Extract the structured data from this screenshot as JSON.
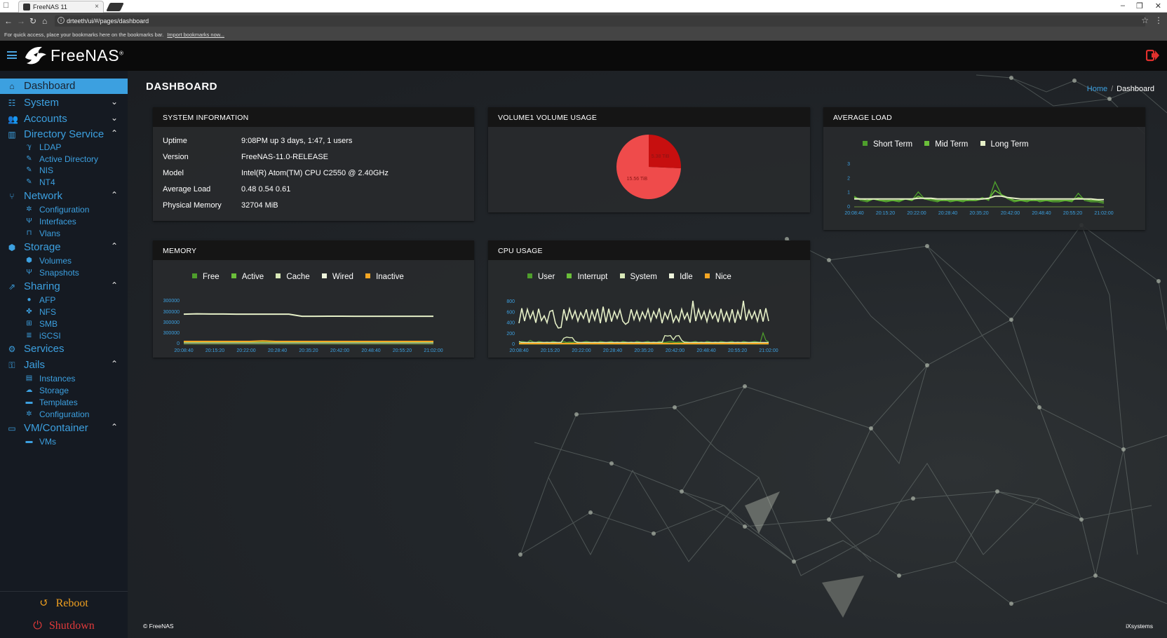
{
  "browser": {
    "tab_title": "FreeNAS 11",
    "url": "drteeth/ui/#/pages/dashboard",
    "bookmarks_hint": "For quick access, place your bookmarks here on the bookmarks bar.",
    "bookmarks_link": "Import bookmarks now..."
  },
  "header": {
    "logo_text": "FreeNAS",
    "logo_mark": "®"
  },
  "sidebar": {
    "dashboard": "Dashboard",
    "system": "System",
    "accounts": "Accounts",
    "directory_service": "Directory Service",
    "ldap": "LDAP",
    "active_directory": "Active Directory",
    "nis": "NIS",
    "nt4": "NT4",
    "network": "Network",
    "net_configuration": "Configuration",
    "interfaces": "Interfaces",
    "vlans": "Vlans",
    "storage": "Storage",
    "volumes": "Volumes",
    "snapshots": "Snapshots",
    "sharing": "Sharing",
    "afp": "AFP",
    "nfs": "NFS",
    "smb": "SMB",
    "iscsi": "iSCSI",
    "services": "Services",
    "jails": "Jails",
    "instances": "Instances",
    "jail_storage": "Storage",
    "templates": "Templates",
    "jail_configuration": "Configuration",
    "vm_container": "VM/Container",
    "vms": "VMs",
    "reboot": "Reboot",
    "shutdown": "Shutdown"
  },
  "page": {
    "title": "DASHBOARD",
    "breadcrumb_home": "Home",
    "breadcrumb_sep": "/",
    "breadcrumb_current": "Dashboard"
  },
  "sysinfo": {
    "title": "SYSTEM INFORMATION",
    "uptime_label": "Uptime",
    "uptime": "9:08PM up 3 days, 1:47, 1 users",
    "version_label": "Version",
    "version": "FreeNAS-11.0-RELEASE",
    "model_label": "Model",
    "model": "Intel(R) Atom(TM) CPU C2550 @ 2.40GHz",
    "load_label": "Average Load",
    "load": "0.48 0.54 0.61",
    "memory_label": "Physical Memory",
    "memory": "32704 MiB"
  },
  "volume": {
    "title": "VOLUME1 VOLUME USAGE",
    "used_label": "15.56 TiB",
    "free_label": "5.38 TiB"
  },
  "avgload": {
    "title": "AVERAGE LOAD",
    "legend": [
      "Short Term",
      "Mid Term",
      "Long Term"
    ]
  },
  "memory": {
    "title": "MEMORY",
    "legend": [
      "Free",
      "Active",
      "Cache",
      "Wired",
      "Inactive"
    ]
  },
  "cpu": {
    "title": "CPU USAGE",
    "legend": [
      "User",
      "Interrupt",
      "System",
      "Idle",
      "Nice"
    ]
  },
  "colors": {
    "accent": "#3ca0e0",
    "green": "#6bbf3a",
    "darkgreen": "#4e9e2c",
    "cream": "#e6f0c8",
    "orange": "#f5a623",
    "pie_used": "#ef4b4b",
    "pie_free": "#c70f0f"
  },
  "chart_data": [
    {
      "type": "pie",
      "title": "VOLUME1 VOLUME USAGE",
      "labels": [
        "15.56 TiB",
        "5.38 TiB"
      ],
      "values": [
        15.56,
        5.38
      ]
    },
    {
      "type": "line",
      "title": "AVERAGE LOAD",
      "x": [
        "20:08:40",
        "20:15:20",
        "20:22:00",
        "20:28:40",
        "20:35:20",
        "20:42:00",
        "20:48:40",
        "20:55:20",
        "21:02:00"
      ],
      "yticks": [
        "0",
        "1",
        "2",
        "3"
      ],
      "ylim": [
        0,
        3
      ],
      "series": [
        {
          "name": "Short Term",
          "values": [
            0.7,
            0.4,
            0.3,
            0.5,
            0.4,
            0.3,
            0.4,
            0.3,
            0.5,
            0.4,
            1.0,
            0.5,
            0.4,
            0.3,
            0.5,
            0.3,
            0.4,
            0.3,
            0.5,
            0.4,
            0.6,
            0.4,
            1.7,
            0.8,
            0.5,
            0.3,
            0.4,
            0.3,
            0.5,
            0.3,
            0.4,
            0.3,
            0.3,
            0.4,
            0.3,
            0.9,
            0.4,
            0.3,
            0.3,
            0.2
          ]
        },
        {
          "name": "Mid Term",
          "values": [
            0.6,
            0.5,
            0.4,
            0.5,
            0.4,
            0.4,
            0.4,
            0.4,
            0.5,
            0.4,
            0.7,
            0.5,
            0.5,
            0.4,
            0.4,
            0.4,
            0.4,
            0.4,
            0.4,
            0.4,
            0.5,
            0.5,
            1.1,
            0.8,
            0.6,
            0.4,
            0.4,
            0.4,
            0.4,
            0.4,
            0.4,
            0.4,
            0.4,
            0.4,
            0.4,
            0.6,
            0.5,
            0.4,
            0.4,
            0.3
          ]
        },
        {
          "name": "Long Term",
          "values": [
            0.5,
            0.5,
            0.5,
            0.5,
            0.5,
            0.5,
            0.5,
            0.5,
            0.5,
            0.5,
            0.55,
            0.55,
            0.55,
            0.5,
            0.5,
            0.5,
            0.5,
            0.5,
            0.5,
            0.5,
            0.5,
            0.55,
            0.7,
            0.7,
            0.6,
            0.55,
            0.5,
            0.5,
            0.5,
            0.5,
            0.5,
            0.5,
            0.5,
            0.5,
            0.5,
            0.5,
            0.5,
            0.5,
            0.45,
            0.45
          ]
        }
      ]
    },
    {
      "type": "line",
      "title": "MEMORY",
      "x": [
        "20:08:40",
        "20:15:20",
        "20:22:00",
        "20:28:40",
        "20:35:20",
        "20:42:00",
        "20:48:40",
        "20:55:20",
        "21:02:00"
      ],
      "yticks": [
        "0",
        "300000",
        "300000",
        "300000",
        "300000"
      ],
      "ylim": [
        0,
        4
      ],
      "series": [
        {
          "name": "Free",
          "values": [
            0.1,
            0.1,
            0.1,
            0.1,
            0.1,
            0.1,
            0.12,
            0.1,
            0.1,
            0.1,
            0.1,
            0.1,
            0.1,
            0.1,
            0.1,
            0.1,
            0.1,
            0.1,
            0.1,
            0.1
          ]
        },
        {
          "name": "Active",
          "values": [
            0.15,
            0.15,
            0.15,
            0.15,
            0.15,
            0.15,
            0.2,
            0.15,
            0.15,
            0.15,
            0.15,
            0.15,
            0.15,
            0.15,
            0.15,
            0.15,
            0.15,
            0.15,
            0.15,
            0.15
          ]
        },
        {
          "name": "Cache",
          "values": [
            0.05,
            0.05,
            0.05,
            0.05,
            0.05,
            0.05,
            0.05,
            0.05,
            0.05,
            0.05,
            0.05,
            0.05,
            0.05,
            0.05,
            0.05,
            0.05,
            0.05,
            0.05,
            0.05,
            0.05
          ]
        },
        {
          "name": "Wired",
          "values": [
            2.75,
            2.78,
            2.76,
            2.76,
            2.75,
            2.75,
            2.75,
            2.75,
            2.75,
            2.55,
            2.55,
            2.56,
            2.56,
            2.55,
            2.55,
            2.55,
            2.55,
            2.55,
            2.55,
            2.55
          ]
        },
        {
          "name": "Inactive",
          "values": [
            0.2,
            0.2,
            0.2,
            0.2,
            0.2,
            0.2,
            0.25,
            0.2,
            0.2,
            0.2,
            0.2,
            0.2,
            0.2,
            0.2,
            0.2,
            0.2,
            0.2,
            0.2,
            0.2,
            0.2
          ]
        }
      ]
    },
    {
      "type": "line",
      "title": "CPU USAGE",
      "x": [
        "20:08:40",
        "20:15:20",
        "20:22:00",
        "20:28:40",
        "20:35:20",
        "20:42:00",
        "20:48:40",
        "20:55:20",
        "21:02:00"
      ],
      "yticks": [
        "0",
        "200",
        "400",
        "600",
        "800"
      ],
      "ylim": [
        0,
        800
      ],
      "series": [
        {
          "name": "User",
          "values": [
            20,
            40,
            30,
            20,
            60,
            30,
            20,
            40,
            30,
            20,
            30,
            20,
            40,
            30,
            20,
            30,
            40,
            20,
            30,
            20,
            40,
            30,
            20,
            30,
            40,
            30,
            20,
            30,
            20,
            40,
            30,
            20,
            30,
            40,
            20,
            30,
            20,
            40,
            30,
            20,
            30,
            20,
            40,
            30,
            20,
            30,
            40,
            20,
            30,
            20,
            40,
            30,
            20,
            30,
            40,
            30,
            20,
            30,
            20,
            40,
            30,
            20,
            30,
            40,
            20,
            30,
            20,
            40,
            30,
            20,
            30,
            20,
            40,
            30,
            20,
            30,
            40,
            20,
            30,
            20,
            40,
            30,
            20,
            30,
            40,
            30,
            20,
            200,
            60,
            30
          ]
        },
        {
          "name": "Interrupt",
          "values": [
            10,
            10,
            10,
            10,
            10,
            10,
            10,
            10,
            10,
            10,
            10,
            10,
            10,
            10,
            10,
            10,
            10,
            10,
            10,
            10,
            10,
            10,
            10,
            10,
            10,
            10,
            10,
            10,
            10,
            10,
            10,
            10,
            10,
            10,
            10,
            10,
            10,
            10,
            10,
            10,
            10,
            10,
            10,
            10,
            10,
            10,
            10,
            10,
            10,
            10,
            10,
            10,
            10,
            10,
            10,
            10,
            10,
            10,
            10,
            10,
            10,
            10,
            10,
            10,
            10,
            10,
            10,
            10,
            10,
            10,
            10,
            10,
            10,
            10,
            10,
            10,
            10,
            10,
            10,
            10,
            10,
            10,
            10,
            10,
            10,
            10,
            10,
            10,
            10,
            10
          ]
        },
        {
          "name": "System",
          "values": [
            40,
            20,
            20,
            20,
            20,
            20,
            20,
            20,
            20,
            20,
            20,
            20,
            20,
            20,
            20,
            20,
            100,
            120,
            110,
            110,
            40,
            20,
            20,
            20,
            20,
            20,
            20,
            20,
            20,
            20,
            20,
            20,
            20,
            20,
            20,
            20,
            20,
            20,
            20,
            20,
            20,
            20,
            20,
            20,
            20,
            20,
            20,
            20,
            20,
            20,
            20,
            20,
            150,
            140,
            150,
            70,
            140,
            150,
            60,
            20,
            20,
            20,
            20,
            20,
            20,
            20,
            20,
            20,
            20,
            20,
            20,
            20,
            20,
            20,
            20,
            20,
            20,
            20,
            20,
            20,
            20,
            20,
            20,
            20,
            20,
            20,
            20,
            20,
            20,
            20
          ]
        },
        {
          "name": "Idle",
          "values": [
            380,
            660,
            420,
            640,
            470,
            600,
            390,
            650,
            430,
            520,
            390,
            600,
            620,
            380,
            290,
            300,
            640,
            430,
            650,
            470,
            610,
            420,
            580,
            470,
            640,
            390,
            610,
            440,
            650,
            380,
            690,
            400,
            650,
            410,
            600,
            470,
            630,
            420,
            360,
            400,
            640,
            450,
            610,
            430,
            590,
            470,
            640,
            420,
            600,
            480,
            660,
            380,
            580,
            460,
            640,
            400,
            520,
            410,
            640,
            460,
            570,
            390,
            860,
            420,
            640,
            460,
            600,
            410,
            620,
            470,
            580,
            400,
            650,
            430,
            590,
            420,
            640,
            390,
            610,
            450,
            860,
            430,
            620,
            470,
            600,
            420,
            640,
            410,
            660,
            420
          ]
        },
        {
          "name": "Nice",
          "values": [
            0,
            0,
            0,
            0,
            0,
            0,
            0,
            0,
            0,
            0,
            0,
            0,
            0,
            0,
            0,
            0,
            0,
            0,
            0,
            0,
            0,
            0,
            0,
            0,
            0,
            0,
            0,
            0,
            0,
            0,
            0,
            0,
            0,
            0,
            0,
            0,
            0,
            0,
            0,
            0,
            0,
            0,
            0,
            0,
            0,
            0,
            0,
            0,
            0,
            0,
            0,
            0,
            0,
            0,
            0,
            0,
            0,
            0,
            0,
            0,
            0,
            0,
            0,
            0,
            0,
            0,
            0,
            0,
            0,
            0,
            0,
            0,
            0,
            0,
            0,
            0,
            0,
            0,
            0,
            0,
            0,
            0,
            0,
            0,
            0,
            0,
            0,
            0,
            0,
            0
          ]
        }
      ]
    }
  ],
  "footer": {
    "left": "© FreeNAS",
    "right": "iXsystems"
  }
}
